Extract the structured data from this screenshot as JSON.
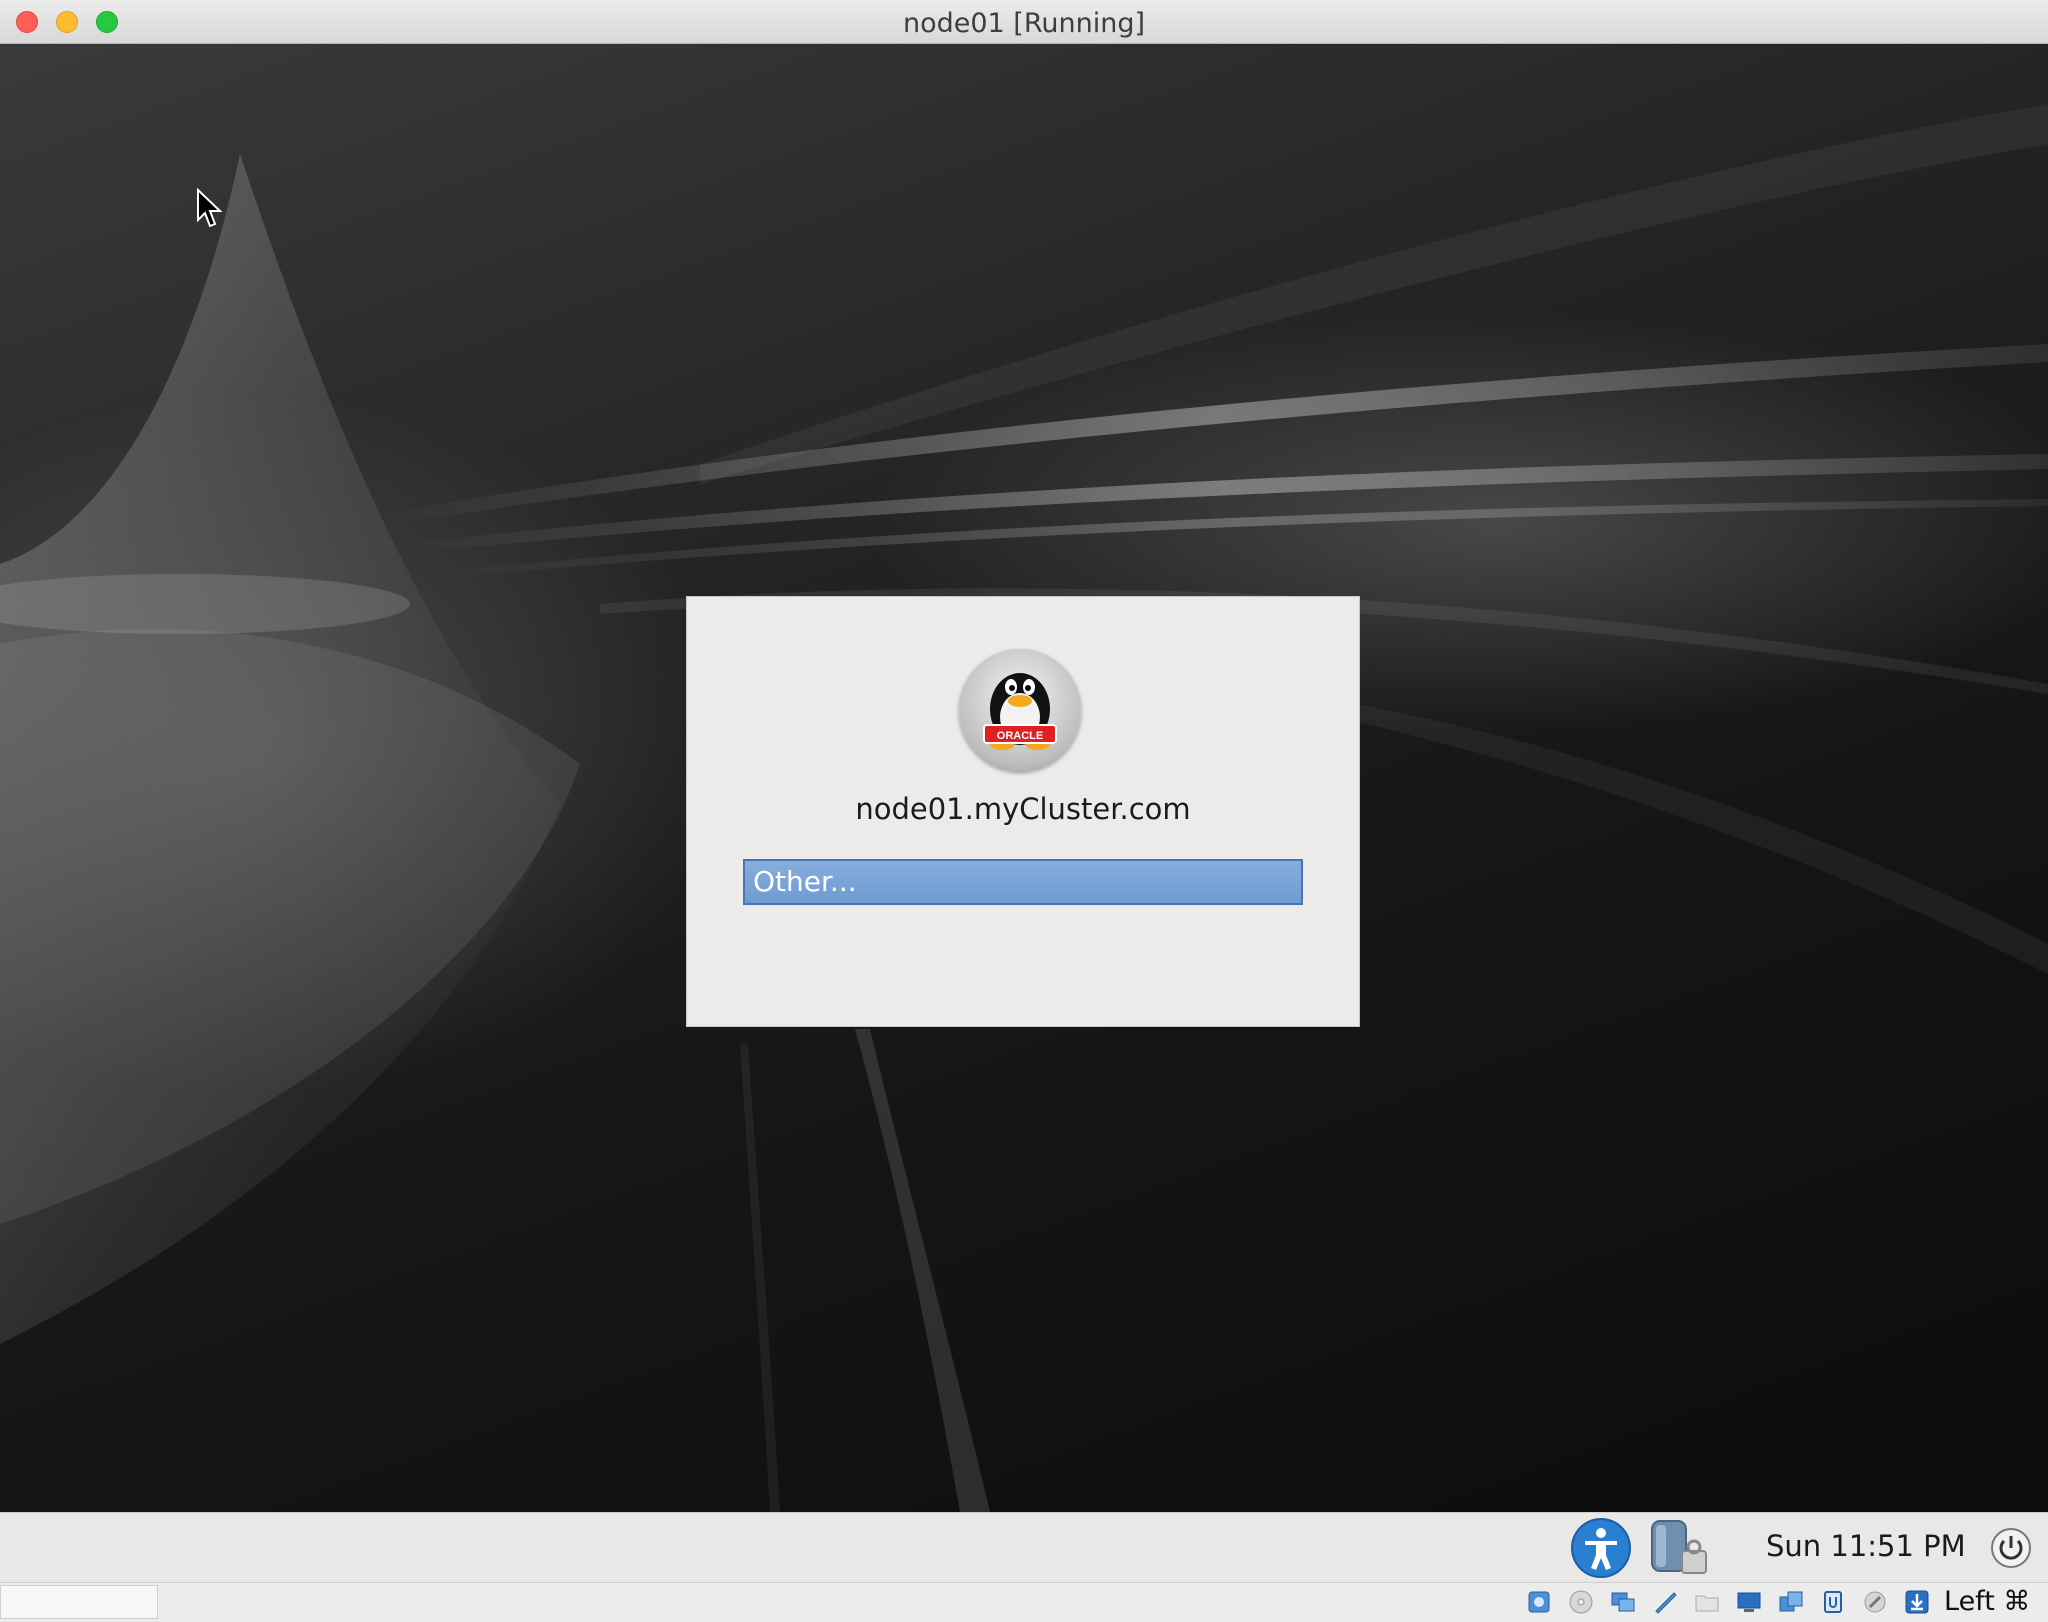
{
  "window": {
    "title": "node01 [Running]",
    "buttons": [
      "close",
      "minimize",
      "zoom"
    ]
  },
  "login": {
    "hostname": "node01.myCluster.com",
    "user_list": [
      {
        "label": "Other...",
        "selected": true
      }
    ],
    "avatar_icon": "oracle-penguin-icon",
    "avatar_badge_text": "ORACLE"
  },
  "panel": {
    "clock": "Sun 11:51 PM",
    "icons": [
      "accessibility-icon",
      "keyboard-layout-icon",
      "power-icon"
    ]
  },
  "statusbar": {
    "host_key": "Left ⌘",
    "icons": [
      "hard-disk-icon",
      "optical-drive-icon",
      "network-icon",
      "usb-icon",
      "shared-folders-icon",
      "display-icon",
      "video-capture-icon",
      "cpu-icon",
      "mouse-integration-icon",
      "download-icon"
    ]
  },
  "colors": {
    "selection": "#7aa3d8",
    "close": "#fc5f57",
    "minimize": "#fdbc2e",
    "zoom": "#28c840",
    "accessibility": "#2a7fd0"
  }
}
